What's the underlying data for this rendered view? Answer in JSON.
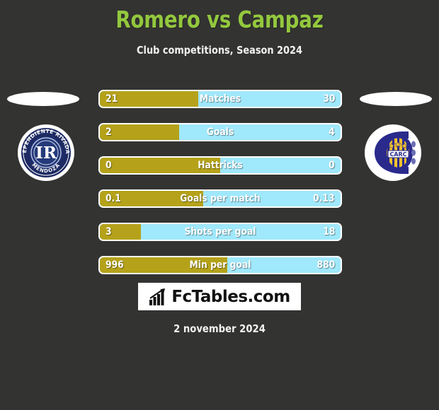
{
  "header": {
    "title": "Romero vs Campaz",
    "subtitle": "Club competitions, Season 2024",
    "title_color": "#93c83e"
  },
  "teams": {
    "left": {
      "crest_name": "independiente-rivadavia-crest",
      "ring_top_text": "INDEPENDIENTE RIVADAVIA",
      "ring_bottom_text": "MENDOZA",
      "monogram": "IR",
      "colors": {
        "primary": "#1d2a63",
        "secondary": "#ffffff"
      }
    },
    "right": {
      "crest_name": "rosario-central-crest",
      "monogram": "CARC",
      "colors": {
        "primary": "#2a2a8c",
        "secondary": "#f2c12e"
      }
    }
  },
  "stats": [
    {
      "label": "Matches",
      "left": "21",
      "right": "30",
      "left_pct": 41
    },
    {
      "label": "Goals",
      "left": "2",
      "right": "4",
      "left_pct": 33
    },
    {
      "label": "Hattricks",
      "left": "0",
      "right": "0",
      "left_pct": 50
    },
    {
      "label": "Goals per match",
      "left": "0.1",
      "right": "0.13",
      "left_pct": 43
    },
    {
      "label": "Shots per goal",
      "left": "3",
      "right": "18",
      "left_pct": 17
    },
    {
      "label": "Min per goal",
      "left": "996",
      "right": "880",
      "left_pct": 53
    }
  ],
  "bar_colors": {
    "left_fill": "#b5a21a",
    "right_fill": "#a0e8fb",
    "border": "#ffffff",
    "text": "#ffffff"
  },
  "brand": {
    "text": "FcTables.com",
    "icon_name": "bar-chart-arrow-icon"
  },
  "footer": {
    "date": "2 november 2024"
  },
  "background_color": "#333331"
}
